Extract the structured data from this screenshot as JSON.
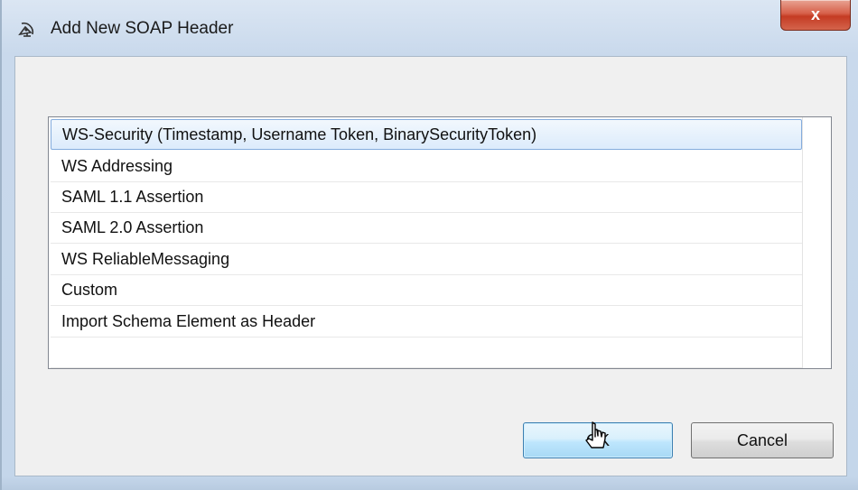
{
  "window": {
    "title": "Add New SOAP Header",
    "close_label": "x"
  },
  "list": {
    "items": [
      "WS-Security (Timestamp, Username Token, BinarySecurityToken)",
      "WS Addressing",
      "SAML 1.1 Assertion",
      "SAML 2.0 Assertion",
      "WS ReliableMessaging",
      "Custom",
      "Import Schema Element as Header"
    ],
    "selected_index": 0
  },
  "buttons": {
    "ok_label": "OK",
    "cancel_label": "Cancel"
  },
  "icons": {
    "app": "satellite-dish-icon",
    "cursor": "mouse-pointer-icon"
  },
  "colors": {
    "selection": "#dcebfc",
    "selection_border": "#84acdd",
    "close": "#c43b23"
  }
}
